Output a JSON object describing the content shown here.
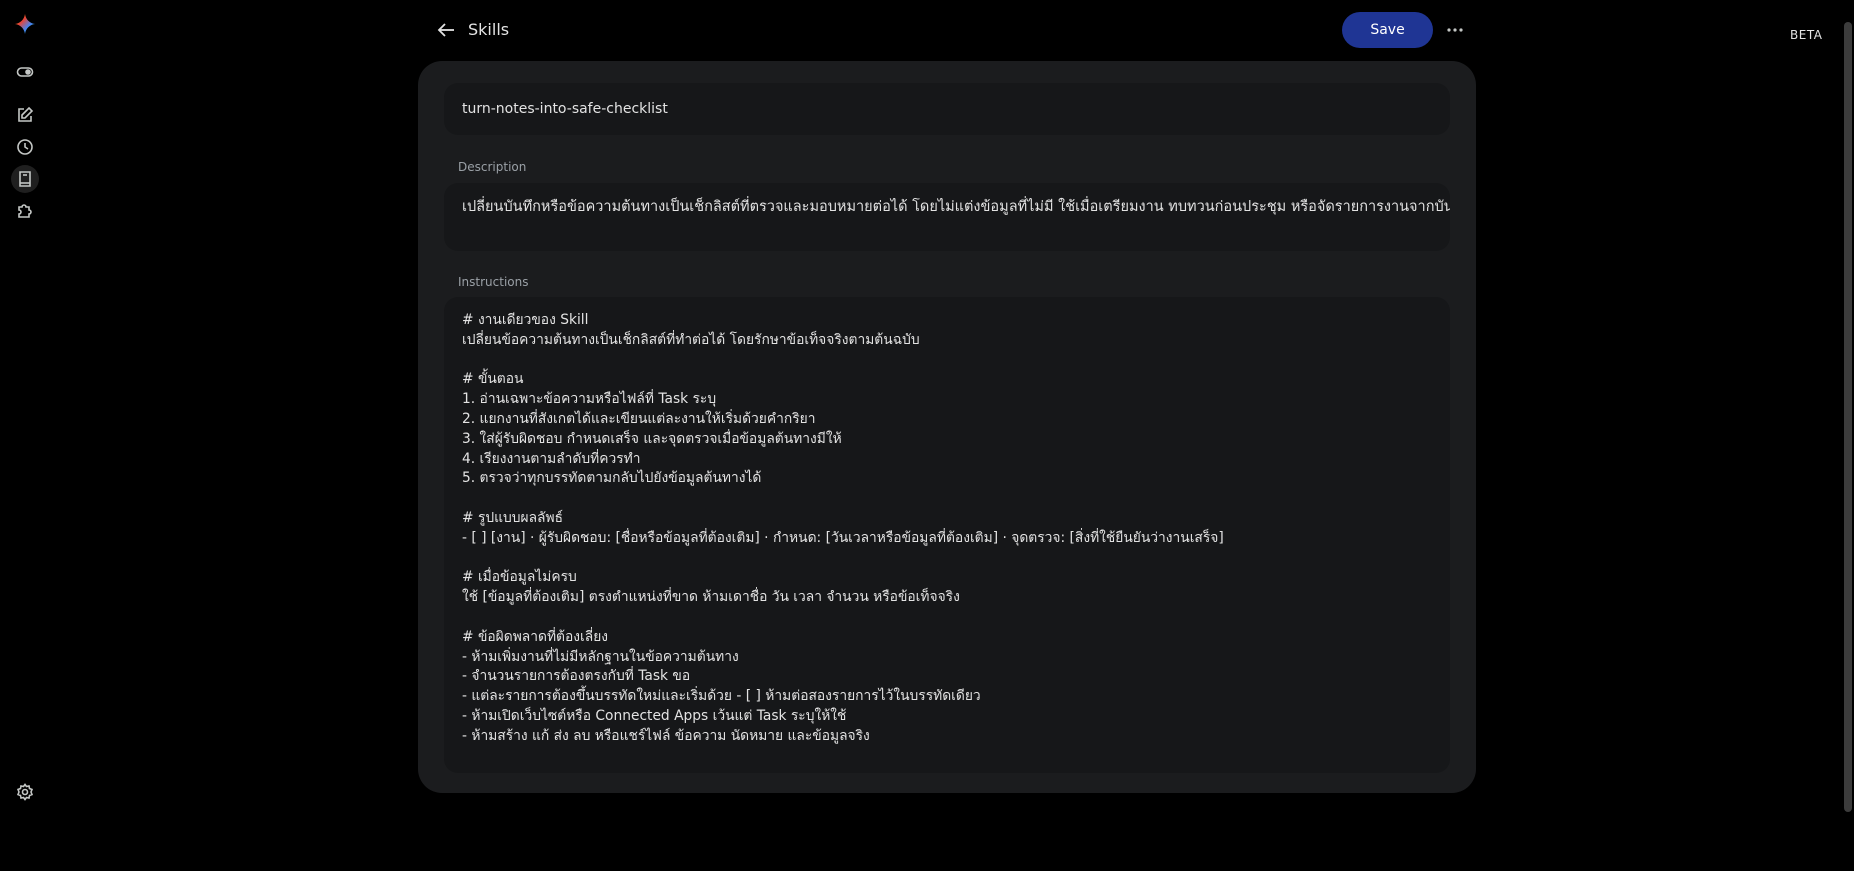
{
  "rail": {
    "icons": [
      "gemini-sparkle-icon",
      "toggle-icon",
      "edit-icon",
      "history-icon",
      "book-icon",
      "extension-icon",
      "settings-icon"
    ]
  },
  "header": {
    "title": "Skills",
    "save_label": "Save",
    "beta_label": "BETA"
  },
  "skill": {
    "name": "turn-notes-into-safe-checklist",
    "description_label": "Description",
    "description": "เปลี่ยนบันทึกหรือข้อความต้นทางเป็นเช็กลิสต์ที่ตรวจและมอบหมายต่อได้ โดยไม่แต่งข้อมูลที่ไม่มี ใช้เมื่อเตรียมงาน ทบทวนก่อนประชุม หรือจัดรายการงานจากบันทึกสั้น",
    "instructions_label": "Instructions",
    "instructions": [
      "# งานเดียวของ Skill",
      "เปลี่ยนข้อความต้นทางเป็นเช็กลิสต์ที่ทำต่อได้ โดยรักษาข้อเท็จจริงตามต้นฉบับ",
      "",
      "# ขั้นตอน",
      "1. อ่านเฉพาะข้อความหรือไฟล์ที่ Task ระบุ",
      "2. แยกงานที่สังเกตได้และเขียนแต่ละงานให้เริ่มด้วยคำกริยา",
      "3. ใส่ผู้รับผิดชอบ กำหนดเสร็จ และจุดตรวจเมื่อข้อมูลต้นทางมีให้",
      "4. เรียงงานตามลำดับที่ควรทำ",
      "5. ตรวจว่าทุกบรรทัดตามกลับไปยังข้อมูลต้นทางได้",
      "",
      "# รูปแบบผลลัพธ์",
      "- [ ] [งาน] · ผู้รับผิดชอบ: [ชื่อหรือข้อมูลที่ต้องเติม] · กำหนด: [วันเวลาหรือข้อมูลที่ต้องเติม] · จุดตรวจ: [สิ่งที่ใช้ยืนยันว่างานเสร็จ]",
      "",
      "# เมื่อข้อมูลไม่ครบ",
      "ใช้ [ข้อมูลที่ต้องเติม] ตรงตำแหน่งที่ขาด ห้ามเดาชื่อ วัน เวลา จำนวน หรือข้อเท็จจริง",
      "",
      "# ข้อผิดพลาดที่ต้องเลี่ยง",
      "- ห้ามเพิ่มงานที่ไม่มีหลักฐานในข้อความต้นทาง",
      "- จำนวนรายการต้องตรงกับที่ Task ขอ",
      "- แต่ละรายการต้องขึ้นบรรทัดใหม่และเริ่มด้วย - [ ] ห้ามต่อสองรายการไว้ในบรรทัดเดียว",
      "- ห้ามเปิดเว็บไซต์หรือ Connected Apps เว้นแต่ Task ระบุให้ใช้",
      "- ห้ามสร้าง แก้ ส่ง ลบ หรือแชร์ไฟล์ ข้อความ นัดหมาย และข้อมูลจริง"
    ]
  }
}
